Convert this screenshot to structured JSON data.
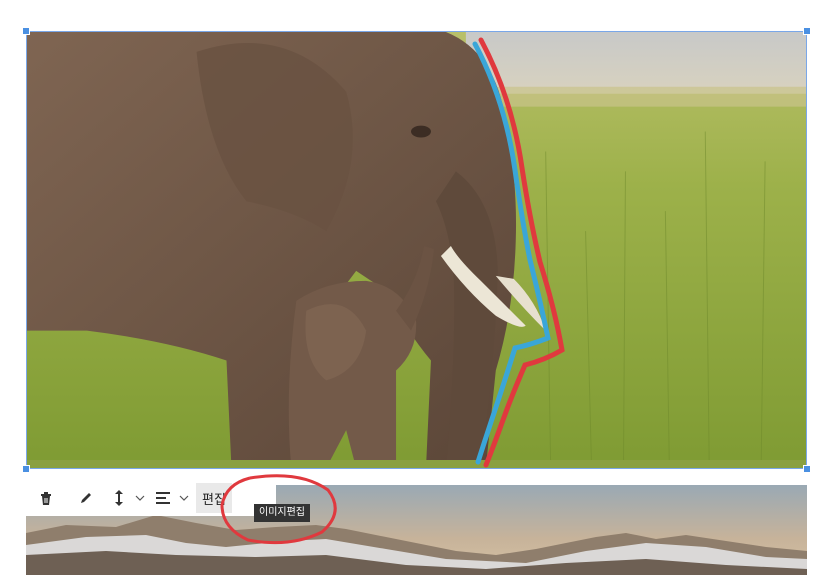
{
  "image": {
    "alt": ""
  },
  "toolbar": {
    "delete_icon": "trash-icon",
    "pencil_icon": "pencil-icon",
    "resize_icon": "vertical-arrows-icon",
    "align_icon": "align-left-icon",
    "edit_label": "편집",
    "tooltip": "이미지편집"
  },
  "colors": {
    "selection": "#7aa7e8",
    "annotation_red": "#e0393e",
    "annotation_blue": "#3aa6d8"
  }
}
